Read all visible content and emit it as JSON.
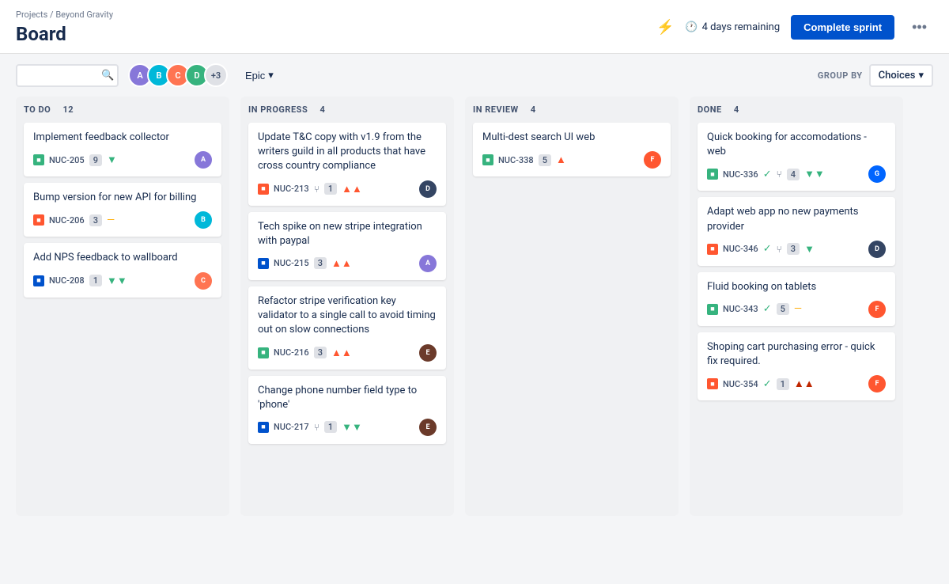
{
  "breadcrumb": "Projects / Beyond Gravity",
  "title": "Board",
  "sprint_icon": "⚡",
  "days_remaining_icon": "🕐",
  "days_remaining": "4 days remaining",
  "complete_sprint": "Complete sprint",
  "more_options": "•••",
  "search_placeholder": "",
  "avatars": [
    {
      "initials": "A",
      "color": "av-purple"
    },
    {
      "initials": "B",
      "color": "av-teal"
    },
    {
      "initials": "C",
      "color": "av-orange"
    },
    {
      "initials": "D",
      "color": "av-green"
    }
  ],
  "avatars_more": "+3",
  "epic_label": "Epic",
  "group_by_label": "GROUP BY",
  "choices_label": "Choices",
  "columns": [
    {
      "id": "todo",
      "title": "TO DO",
      "count": 12,
      "cards": [
        {
          "title": "Implement feedback collector",
          "issue_type": "green",
          "issue_id": "NUC-205",
          "count": "9",
          "priority": "low",
          "priority_symbol": "▼",
          "avatar_color": "av-purple",
          "avatar_initials": "A"
        },
        {
          "title": "Bump version for new API for billing",
          "issue_type": "red",
          "issue_id": "NUC-206",
          "count": "3",
          "priority": "medium",
          "priority_symbol": "—",
          "avatar_color": "av-teal",
          "avatar_initials": "B"
        },
        {
          "title": "Add NPS feedback to wallboard",
          "issue_type": "blue",
          "issue_id": "NUC-208",
          "count": "1",
          "priority": "low",
          "priority_symbol": "▼▼",
          "avatar_color": "av-orange",
          "avatar_initials": "C"
        }
      ]
    },
    {
      "id": "inprogress",
      "title": "IN PROGRESS",
      "count": 4,
      "cards": [
        {
          "title": "Update T&C copy with v1.9 from the writers guild in all products that have cross country compliance",
          "issue_type": "red",
          "issue_id": "NUC-213",
          "branch": true,
          "count": "1",
          "priority": "high",
          "priority_symbol": "▲▲",
          "avatar_color": "av-dark",
          "avatar_initials": "D"
        },
        {
          "title": "Tech spike on new stripe integration with paypal",
          "issue_type": "blue",
          "issue_id": "NUC-215",
          "count": "3",
          "priority": "high",
          "priority_symbol": "▲▲",
          "avatar_color": "av-purple",
          "avatar_initials": "A"
        },
        {
          "title": "Refactor stripe verification key validator to a single call to avoid timing out on slow connections",
          "issue_type": "green",
          "issue_id": "NUC-216",
          "count": "3",
          "priority": "high",
          "priority_symbol": "▲▲",
          "avatar_color": "av-brown",
          "avatar_initials": "E"
        },
        {
          "title": "Change phone number field type to 'phone'",
          "issue_type": "blue",
          "issue_id": "NUC-217",
          "branch": true,
          "count": "1",
          "priority": "low",
          "priority_symbol": "▼▼",
          "avatar_color": "av-brown",
          "avatar_initials": "E"
        }
      ]
    },
    {
      "id": "inreview",
      "title": "IN REVIEW",
      "count": 4,
      "cards": [
        {
          "title": "Multi-dest search UI web",
          "issue_type": "green",
          "issue_id": "NUC-338",
          "count": "5",
          "priority": "high",
          "priority_symbol": "▲",
          "avatar_color": "av-pink",
          "avatar_initials": "F"
        }
      ]
    },
    {
      "id": "done",
      "title": "DONE",
      "count": 4,
      "cards": [
        {
          "title": "Quick booking for accomodations - web",
          "issue_type": "green",
          "issue_id": "NUC-336",
          "check": true,
          "branch": true,
          "count": "4",
          "priority": "low",
          "priority_symbol": "▼▼",
          "avatar_color": "av-blue",
          "avatar_initials": "G"
        },
        {
          "title": "Adapt web app no new payments provider",
          "issue_type": "red",
          "issue_id": "NUC-346",
          "check": true,
          "branch": true,
          "count": "3",
          "priority": "low",
          "priority_symbol": "▼",
          "avatar_color": "av-dark",
          "avatar_initials": "D"
        },
        {
          "title": "Fluid booking on tablets",
          "issue_type": "green",
          "issue_id": "NUC-343",
          "check": true,
          "count": "5",
          "priority": "medium",
          "priority_symbol": "—",
          "avatar_color": "av-pink",
          "avatar_initials": "F"
        },
        {
          "title": "Shoping cart purchasing error - quick fix required.",
          "issue_type": "red",
          "issue_id": "NUC-354",
          "check": true,
          "count": "1",
          "priority": "critical",
          "priority_symbol": "▲▲",
          "avatar_color": "av-pink",
          "avatar_initials": "F"
        }
      ]
    }
  ]
}
